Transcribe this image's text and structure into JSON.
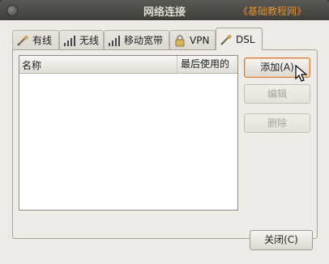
{
  "window": {
    "title": "网络连接",
    "watermark": "《基础教程网》"
  },
  "tabs": [
    {
      "label": "有线",
      "icon": "wired-plug-icon",
      "active": false
    },
    {
      "label": "无线",
      "icon": "wireless-signal-icon",
      "active": false
    },
    {
      "label": "移动宽带",
      "icon": "mobile-broadband-signal-icon",
      "active": false
    },
    {
      "label": "VPN",
      "icon": "vpn-lock-icon",
      "active": false
    },
    {
      "label": "DSL",
      "icon": "dsl-plug-icon",
      "active": true
    }
  ],
  "list": {
    "columns": [
      "名称",
      "最后使用的"
    ],
    "rows": []
  },
  "buttons": {
    "add": "添加(A)",
    "edit": "编辑",
    "delete": "删除",
    "close": "关闭(C)"
  },
  "colors": {
    "titlebar": "#3f3e3a",
    "watermark": "#e5902e",
    "focus": "#d07a3a"
  }
}
